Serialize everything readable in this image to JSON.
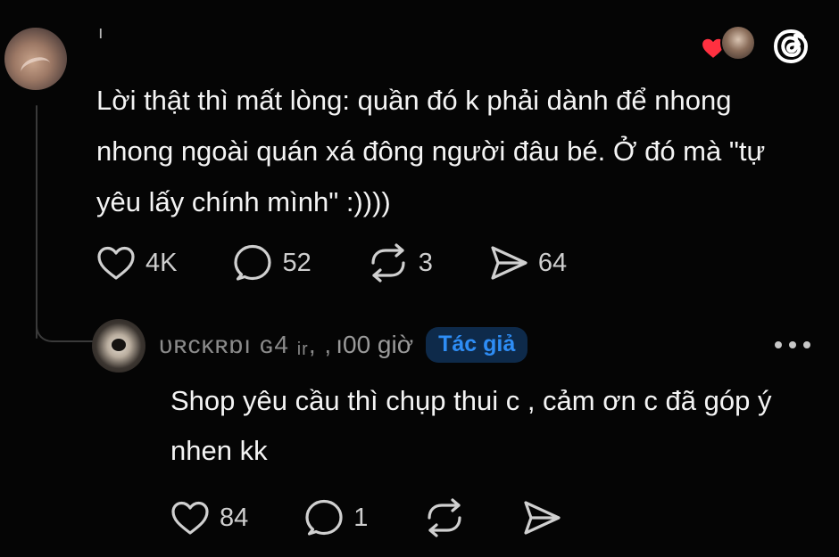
{
  "post": {
    "username": "ı",
    "text": "Lời thật thì mất lòng: quần đó k phải dành để nhong nhong ngoài quán xá đông người đâu bé. Ở đó mà \"tự yêu lấy chính mình\" :))))",
    "actions": {
      "like_count": "4K",
      "comment_count": "52",
      "repost_count": "3",
      "share_count": "64"
    }
  },
  "reply": {
    "username": "ᴜʀcĸʀɒı ɢ4 ᵢᵣ, ,",
    "time": "ı00 giờ",
    "author_badge": "Tác giả",
    "text": "Shop yêu cầu thì chụp thui c , cảm ơn c đã góp ý nhen kk",
    "actions": {
      "like_count": "84",
      "comment_count": "1"
    }
  },
  "colors": {
    "background": "#050505",
    "text": "#f4f4f4",
    "badge_text": "#2e8df5",
    "badge_bg": "#0e2a4a",
    "heart": "#ff3040"
  },
  "icons": {
    "like": "heart-icon",
    "comment": "comment-icon",
    "repost": "repost-icon",
    "share": "send-icon",
    "logo": "threads-logo-icon"
  }
}
